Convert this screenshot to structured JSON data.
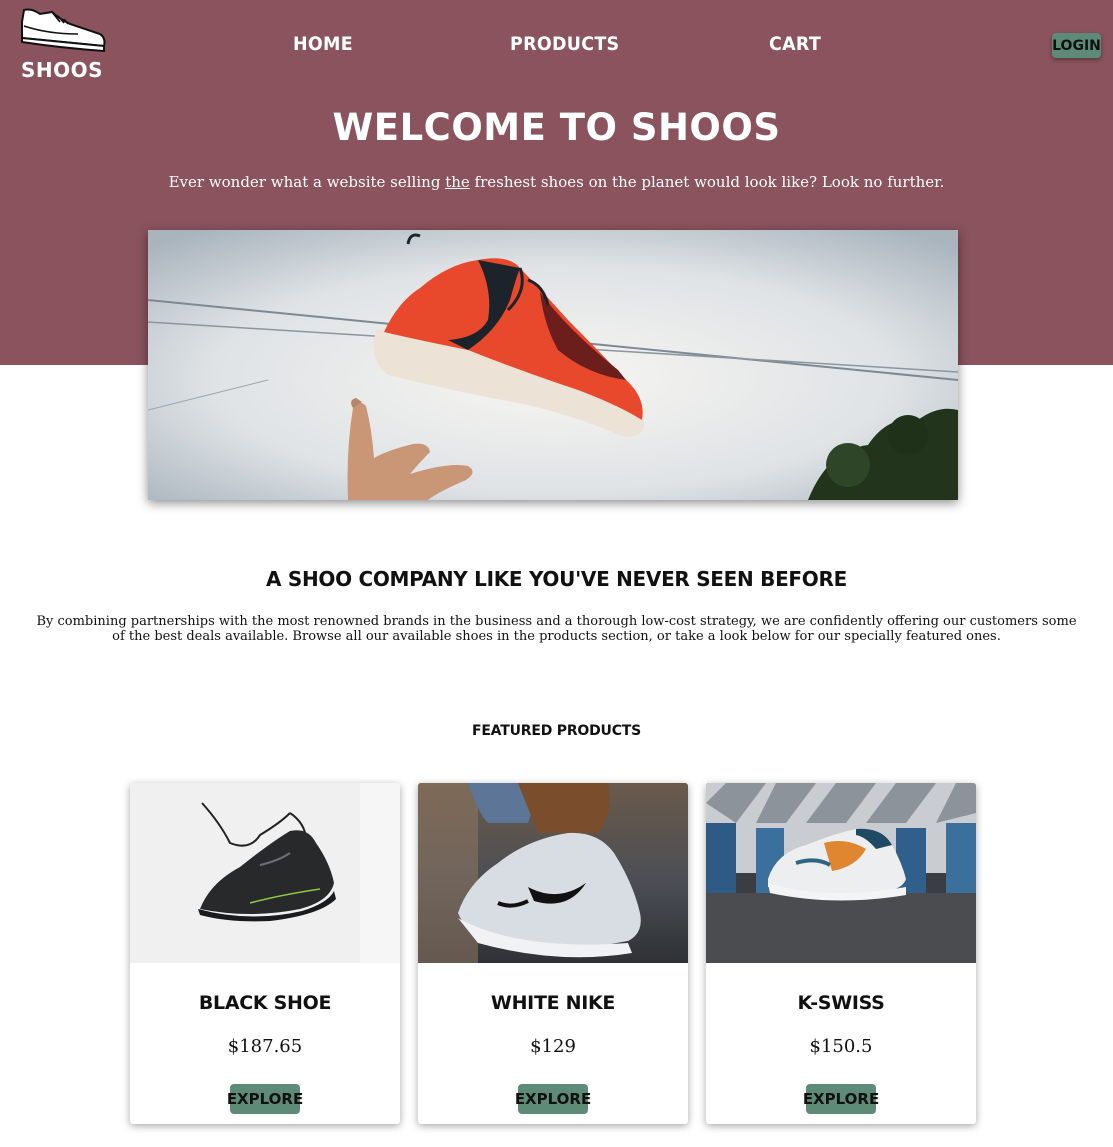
{
  "colors": {
    "brand": "#8a535e",
    "accent": "#5e8a78",
    "text": "#111111"
  },
  "header": {
    "logo_text": "SHOOS",
    "logo_icon": "sneaker-outline-icon",
    "nav": [
      {
        "label": "HOME"
      },
      {
        "label": "PRODUCTS"
      },
      {
        "label": "CART"
      }
    ],
    "login_label": "LOGIN"
  },
  "hero": {
    "title": "WELCOME TO SHOOS",
    "subtitle_before": "Ever wonder what a website selling ",
    "subtitle_emphasis": "the",
    "subtitle_after": " freshest shoes on the planet would look like? Look no further.",
    "image_icon": "flying-sneaker-photo"
  },
  "about": {
    "title": "A SHOO COMPANY LIKE YOU'VE NEVER SEEN BEFORE",
    "body": "By combining partnerships with the most renowned brands in the business and a thorough low-cost strategy, we are confidently offering our customers some of the best deals available. Browse all our available shoes in the products section, or take a look below for our specially featured ones."
  },
  "featured": {
    "title": "FEATURED PRODUCTS",
    "products": [
      {
        "name": "BLACK SHOE",
        "price": "$187.65",
        "button": "EXPLORE",
        "image_icon": "black-shoe-photo"
      },
      {
        "name": "WHITE NIKE",
        "price": "$129",
        "button": "EXPLORE",
        "image_icon": "white-nike-photo"
      },
      {
        "name": "K-SWISS",
        "price": "$150.5",
        "button": "EXPLORE",
        "image_icon": "k-swiss-photo"
      }
    ]
  }
}
